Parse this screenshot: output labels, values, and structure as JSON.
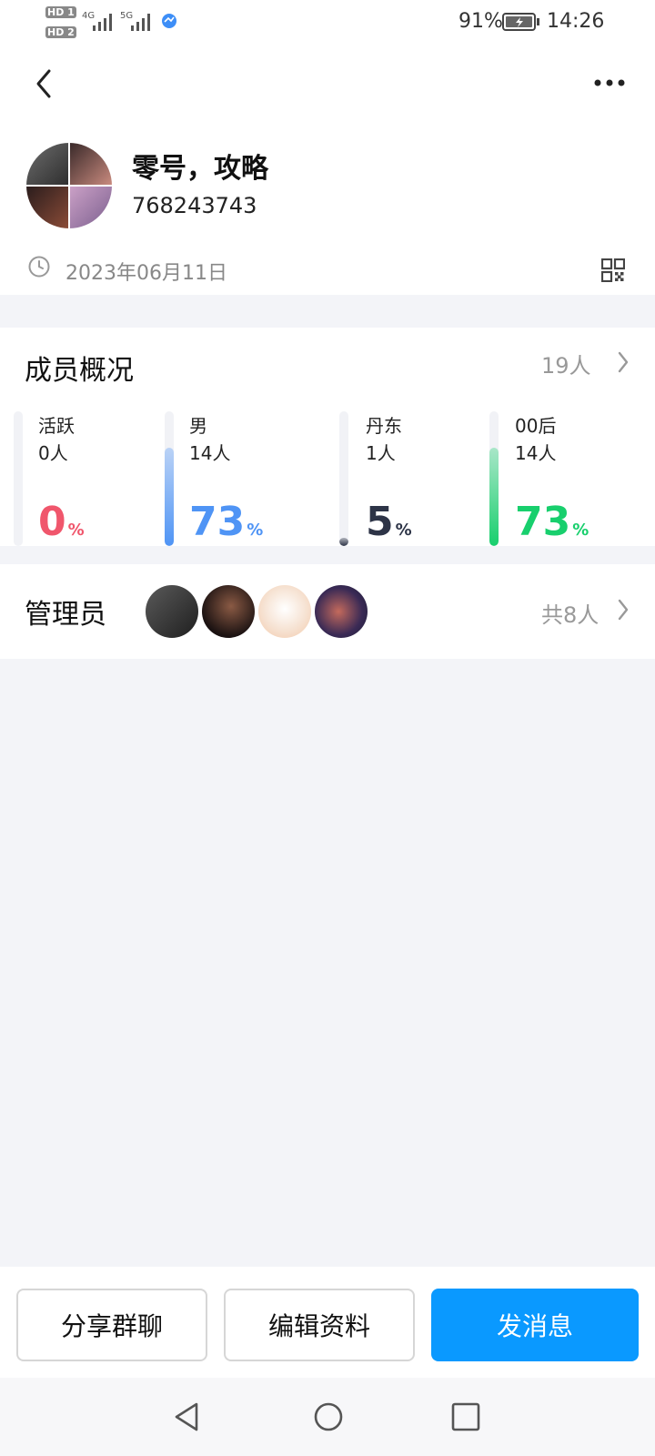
{
  "status_bar": {
    "sim1": "HD 1",
    "sim2": "HD 2",
    "net1": "4G",
    "net2": "5G",
    "battery": "91%",
    "time": "14:26"
  },
  "header": {
    "group_name": "零号，攻略",
    "group_id": "768243743",
    "created_date": "2023年06月11日"
  },
  "members": {
    "title": "成员概况",
    "count": "19人",
    "stats": [
      {
        "label": "活跃",
        "count": "0人",
        "percent": "0",
        "unit": "%",
        "fraction": 0.0,
        "color": "#f0566c"
      },
      {
        "label": "男",
        "count": "14人",
        "percent": "73",
        "unit": "%",
        "fraction": 0.73,
        "color": "#4f94f5"
      },
      {
        "label": "丹东",
        "count": "1人",
        "percent": "5",
        "unit": "%",
        "fraction": 0.05,
        "color": "#2d3447"
      },
      {
        "label": "00后",
        "count": "14人",
        "percent": "73",
        "unit": "%",
        "fraction": 0.73,
        "color": "#18cf6d"
      }
    ]
  },
  "admins": {
    "title": "管理员",
    "count": "共8人"
  },
  "actions": {
    "share": "分享群聊",
    "edit": "编辑资料",
    "message": "发消息"
  },
  "colors": {
    "accent": "#0a99ff",
    "page_bg": "#f3f4f8"
  }
}
